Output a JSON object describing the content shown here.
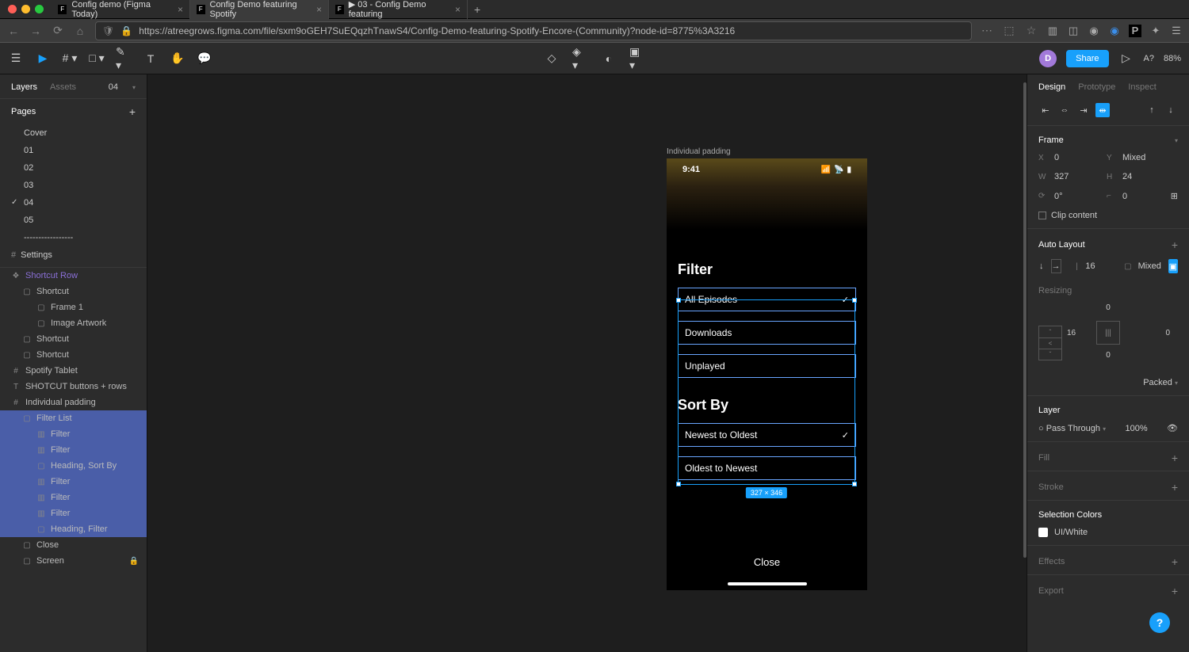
{
  "browser": {
    "tabs": [
      {
        "title": "Config demo (Figma Today)",
        "active": false
      },
      {
        "title": "Config Demo featuring Spotify",
        "active": true
      },
      {
        "title": "▶ 03 - Config Demo featuring",
        "active": false
      }
    ],
    "url": "https://atreegrows.figma.com/file/sxm9oGEH7SuEQqzhTnawS4/Config-Demo-featuring-Spotify-Encore-(Community)?node-id=8775%3A3216"
  },
  "toolbar": {
    "avatar": "D",
    "share": "Share",
    "zoom": "88%",
    "a_mark": "A?"
  },
  "left": {
    "tabs": {
      "layers": "Layers",
      "assets": "Assets",
      "page_num": "04"
    },
    "pages_label": "Pages",
    "pages": [
      "Cover",
      "01",
      "02",
      "03",
      "04",
      "05",
      "-----------------",
      "Settings"
    ],
    "active_page": "04",
    "layers": [
      {
        "name": "Shortcut Row",
        "icon": "❖",
        "depth": 0,
        "cls": "comp"
      },
      {
        "name": "Shortcut",
        "icon": "▢",
        "depth": 1
      },
      {
        "name": "Frame 1",
        "icon": "▢",
        "depth": 2
      },
      {
        "name": "Image Artwork",
        "icon": "▢",
        "depth": 2
      },
      {
        "name": "Shortcut",
        "icon": "▢",
        "depth": 1
      },
      {
        "name": "Shortcut",
        "icon": "▢",
        "depth": 1
      },
      {
        "name": "Spotify Tablet",
        "icon": "#",
        "depth": 0
      },
      {
        "name": "SHOTCUT buttons + rows",
        "icon": "T",
        "depth": 0
      },
      {
        "name": "Individual padding",
        "icon": "#",
        "depth": 0
      },
      {
        "name": "Filter List",
        "icon": "▢",
        "depth": 1,
        "sel": true
      },
      {
        "name": "Filter",
        "icon": "▥",
        "depth": 2,
        "sel": true
      },
      {
        "name": "Filter",
        "icon": "▥",
        "depth": 2,
        "sel": true
      },
      {
        "name": "Heading, Sort By",
        "icon": "▢",
        "depth": 2,
        "sel": true
      },
      {
        "name": "Filter",
        "icon": "▥",
        "depth": 2,
        "sel": true
      },
      {
        "name": "Filter",
        "icon": "▥",
        "depth": 2,
        "sel": true
      },
      {
        "name": "Filter",
        "icon": "▥",
        "depth": 2,
        "sel": true
      },
      {
        "name": "Heading, Filter",
        "icon": "▢",
        "depth": 2,
        "sel": true
      },
      {
        "name": "Close",
        "icon": "▢",
        "depth": 1
      },
      {
        "name": "Screen",
        "icon": "▢",
        "depth": 1,
        "locked": true
      }
    ]
  },
  "canvas": {
    "frame_label": "Individual padding",
    "time": "9:41",
    "filter_h": "Filter",
    "sort_h": "Sort By",
    "options": {
      "all": "All Episodes",
      "downloads": "Downloads",
      "unplayed": "Unplayed",
      "newest": "Newest to Oldest",
      "oldest": "Oldest to Newest"
    },
    "close": "Close",
    "dim": "327 × 346"
  },
  "right": {
    "tabs": {
      "design": "Design",
      "proto": "Prototype",
      "inspect": "Inspect"
    },
    "frame_label": "Frame",
    "x": "0",
    "y": "Mixed",
    "w": "327",
    "h": "24",
    "rot": "0°",
    "rad": "0",
    "clip": "Clip content",
    "auto_layout": "Auto Layout",
    "gap": "16",
    "pad_mixed": "Mixed",
    "resizing": "Resizing",
    "pad_top": "0",
    "pad_right": "0",
    "pad_bottom": "0",
    "pad_left": "16",
    "packed": "Packed",
    "layer": "Layer",
    "blend": "Pass Through",
    "opacity": "100%",
    "fill": "Fill",
    "stroke": "Stroke",
    "sel_colors": "Selection Colors",
    "color_name": "UI/White",
    "effects": "Effects",
    "export": "Export"
  }
}
